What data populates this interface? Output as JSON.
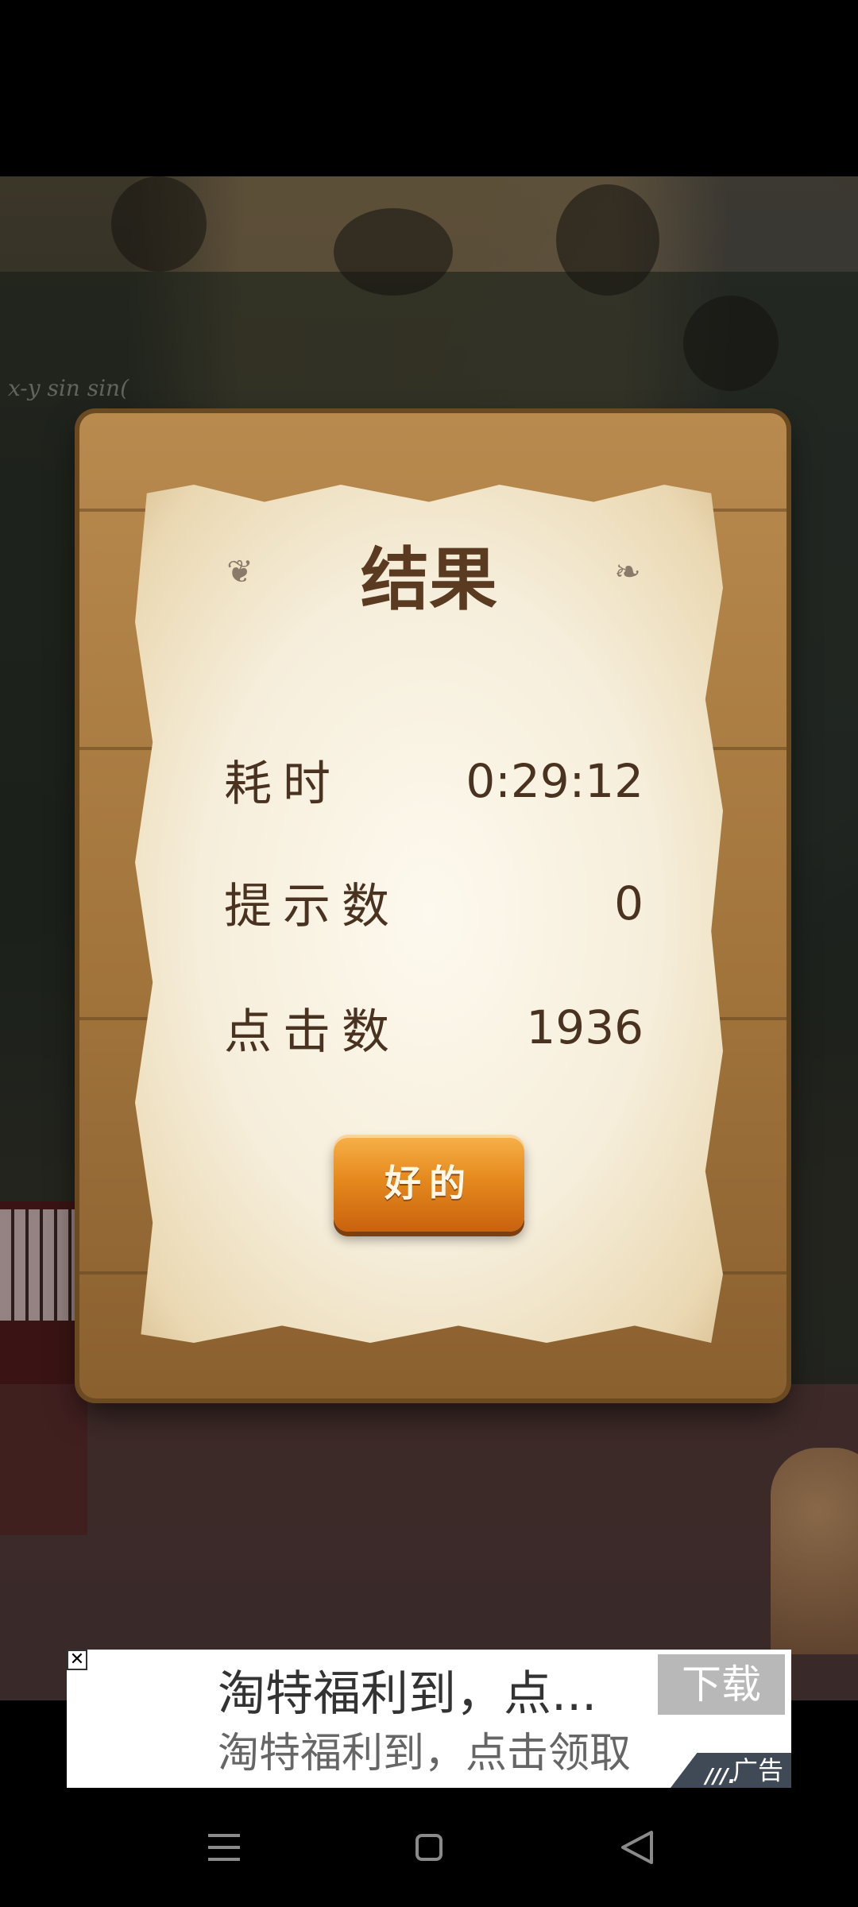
{
  "dialog": {
    "title": "结果",
    "rows": [
      {
        "label": "耗时",
        "value": "0:29:12"
      },
      {
        "label": "提示数",
        "value": "0"
      },
      {
        "label": "点击数",
        "value": "1936"
      }
    ],
    "ok_button": "好的"
  },
  "ad": {
    "close_symbol": "✕",
    "title": "淘特福利到，点...",
    "subtitle": "淘特福利到，点击领取",
    "download_label": "下载",
    "tag_label": "广告"
  },
  "navbar": {
    "icons": [
      "menu-icon",
      "home-icon",
      "back-icon"
    ]
  }
}
